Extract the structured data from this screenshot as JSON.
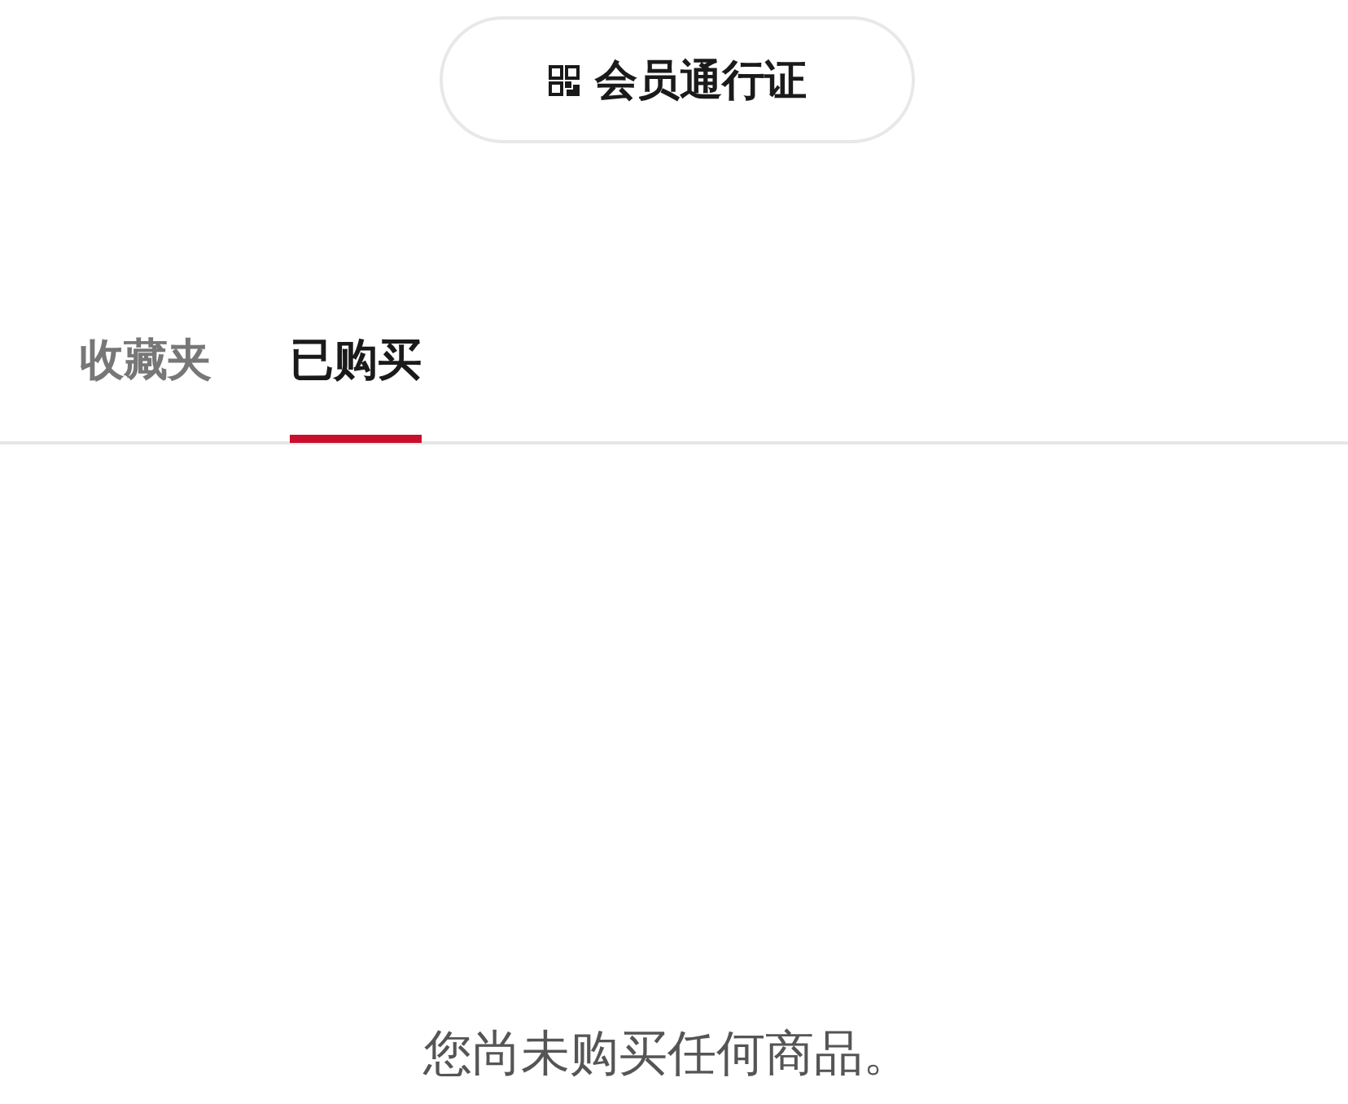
{
  "pass_button": {
    "label": "会员通行证"
  },
  "tabs": [
    {
      "label": "收藏夹",
      "selected": false
    },
    {
      "label": "已购买",
      "selected": true
    }
  ],
  "empty_message": "您尚未购买任何商品。"
}
